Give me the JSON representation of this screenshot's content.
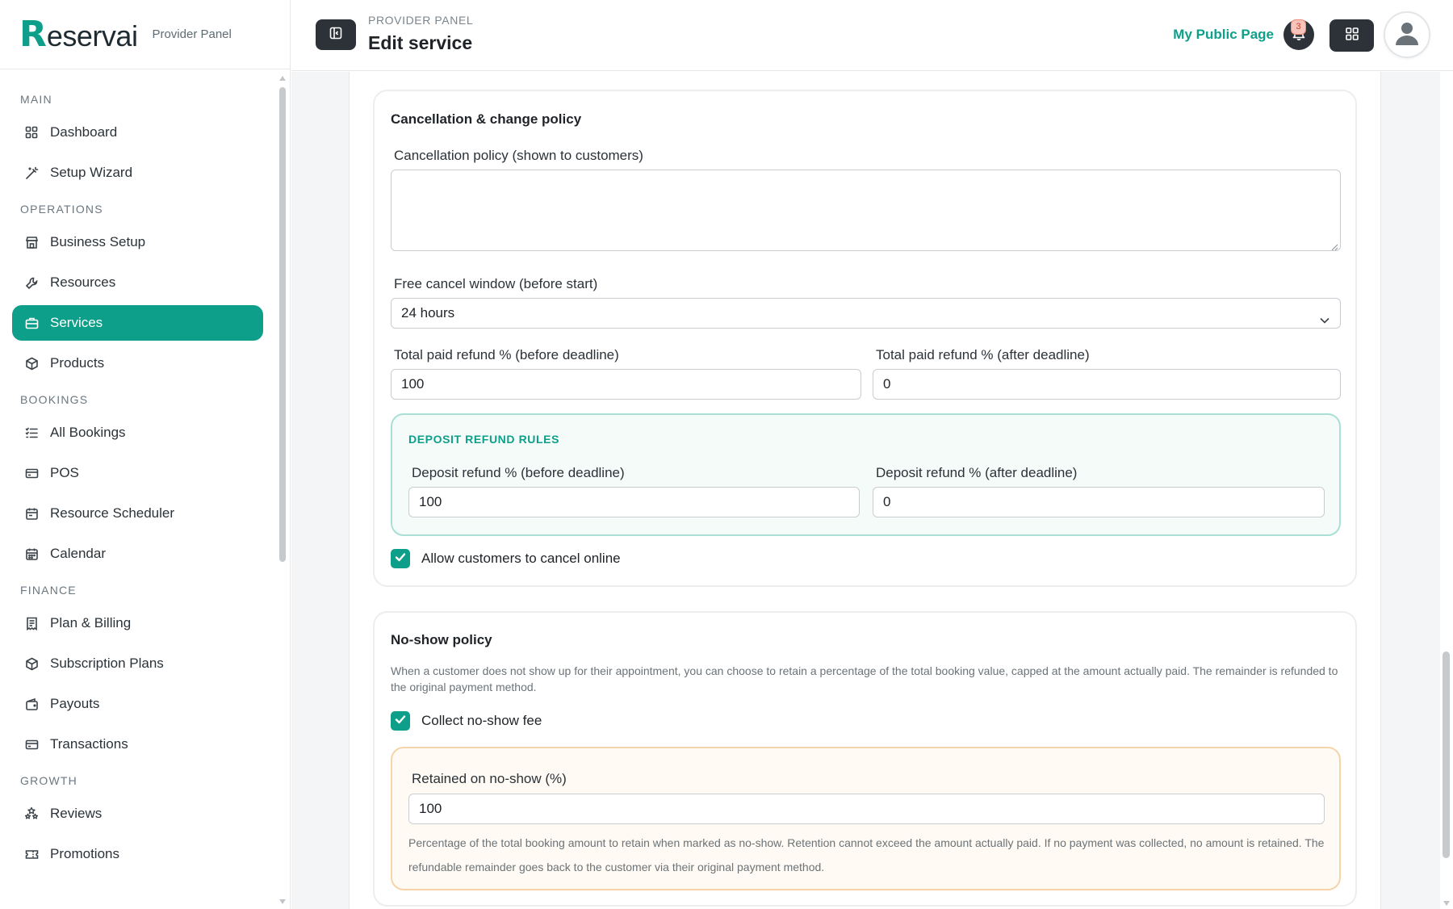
{
  "brand": {
    "name_initial": "R",
    "name_rest": "eservai",
    "subtitle": "Provider Panel"
  },
  "sidebar": {
    "sections": [
      {
        "label": "MAIN",
        "items": [
          {
            "label": "Dashboard",
            "icon": "dashboard-icon"
          },
          {
            "label": "Setup Wizard",
            "icon": "wand-icon"
          }
        ]
      },
      {
        "label": "OPERATIONS",
        "items": [
          {
            "label": "Business Setup",
            "icon": "store-icon"
          },
          {
            "label": "Resources",
            "icon": "wrench-icon"
          },
          {
            "label": "Services",
            "icon": "briefcase-icon",
            "active": true
          },
          {
            "label": "Products",
            "icon": "box-icon"
          }
        ]
      },
      {
        "label": "BOOKINGS",
        "items": [
          {
            "label": "All Bookings",
            "icon": "list-icon"
          },
          {
            "label": "POS",
            "icon": "card-icon"
          },
          {
            "label": "Resource Scheduler",
            "icon": "calendar-icon"
          },
          {
            "label": "Calendar",
            "icon": "calendar-grid-icon"
          }
        ]
      },
      {
        "label": "FINANCE",
        "items": [
          {
            "label": "Plan & Billing",
            "icon": "receipt-icon"
          },
          {
            "label": "Subscription Plans",
            "icon": "box-icon"
          },
          {
            "label": "Payouts",
            "icon": "wallet-icon"
          },
          {
            "label": "Transactions",
            "icon": "card-icon"
          }
        ]
      },
      {
        "label": "GROWTH",
        "items": [
          {
            "label": "Reviews",
            "icon": "stars-icon"
          },
          {
            "label": "Promotions",
            "icon": "ticket-icon"
          }
        ]
      }
    ]
  },
  "header": {
    "breadcrumb": "PROVIDER PANEL",
    "title": "Edit service",
    "public_link": "My Public Page",
    "notification_count": "3"
  },
  "cancellation": {
    "title": "Cancellation & change policy",
    "policy_label": "Cancellation policy (shown to customers)",
    "policy_value": "",
    "window_label": "Free cancel window (before start)",
    "window_value": "24 hours",
    "refund_before_label": "Total paid refund % (before deadline)",
    "refund_before_value": "100",
    "refund_after_label": "Total paid refund % (after deadline)",
    "refund_after_value": "0",
    "deposit": {
      "title": "DEPOSIT REFUND RULES",
      "before_label": "Deposit refund % (before deadline)",
      "before_value": "100",
      "after_label": "Deposit refund % (after deadline)",
      "after_value": "0"
    },
    "allow_online_label": "Allow customers to cancel online",
    "allow_online_checked": true
  },
  "noshow": {
    "title": "No-show policy",
    "description": "When a customer does not show up for their appointment, you can choose to retain a percentage of the total booking value, capped at the amount actually paid. The remainder is refunded to the original payment method.",
    "collect_label": "Collect no-show fee",
    "collect_checked": true,
    "retained_label": "Retained on no-show (%)",
    "retained_value": "100",
    "retained_help": "Percentage of the total booking amount to retain when marked as no-show. Retention cannot exceed the amount actually paid. If no payment was collected, no amount is retained. The refundable remainder goes back to the customer via their original payment method."
  },
  "colors": {
    "accent": "#0e9f8a",
    "dark_button": "#2d3238",
    "deposit_bg": "#f4fbf9",
    "noshow_bg": "#fffaf3"
  }
}
